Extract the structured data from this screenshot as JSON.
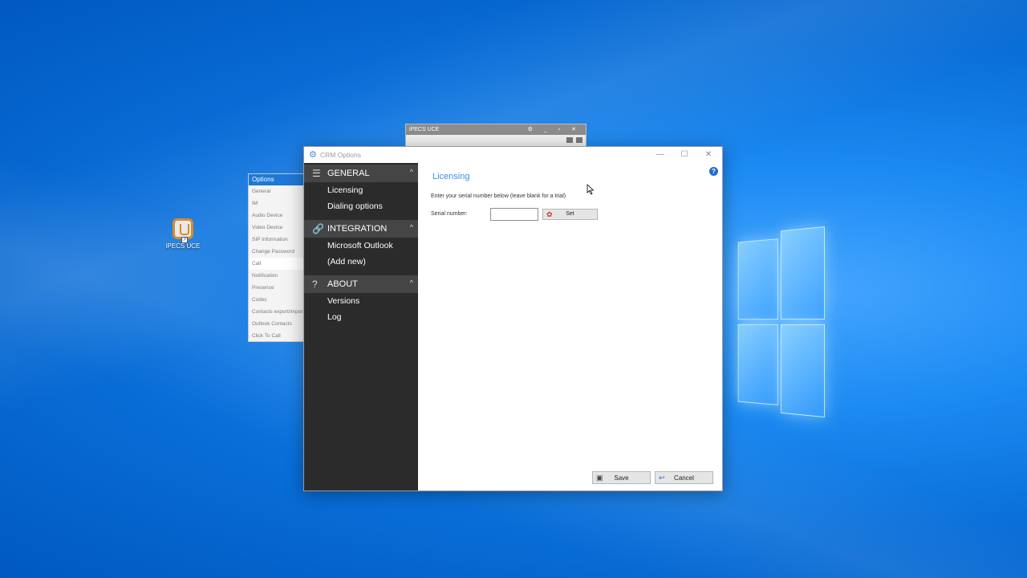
{
  "desktop": {
    "icon_label": "iPECS UCE"
  },
  "options_window": {
    "title": "Options",
    "items": [
      "General",
      "IM",
      "Audio Device",
      "Video Device",
      "SIP Information",
      "Change Password",
      "Call",
      "Notification",
      "Presence",
      "Codec",
      "Contacts export/import",
      "Outlook Contacts",
      "Click To Call"
    ],
    "selected": "Call"
  },
  "ipecs_window": {
    "title": "iPECS UCE",
    "controls": "⚙ _ ▫ ✕"
  },
  "crm_window": {
    "title": "CRM Options",
    "controls": {
      "minimize": "—",
      "maximize": "☐",
      "close": "✕"
    },
    "sidebar": {
      "sections": [
        {
          "icon": "menu-icon",
          "glyph": "☰",
          "title": "GENERAL",
          "items": [
            "Licensing",
            "Dialing options"
          ]
        },
        {
          "icon": "link-icon",
          "glyph": "🔗",
          "title": "INTEGRATION",
          "items": [
            "Microsoft Outlook",
            "(Add new)"
          ]
        },
        {
          "icon": "question-icon",
          "glyph": "?",
          "title": "ABOUT",
          "items": [
            "Versions",
            "Log"
          ]
        }
      ],
      "chevron": "^"
    },
    "content": {
      "heading": "Licensing",
      "help": "?",
      "instruction": "Enter your serial number below (leave blank for a trial)",
      "serial_label": "Serial number:",
      "serial_value": "",
      "set_label": "Set",
      "save_label": "Save",
      "cancel_label": "Cancel"
    }
  }
}
